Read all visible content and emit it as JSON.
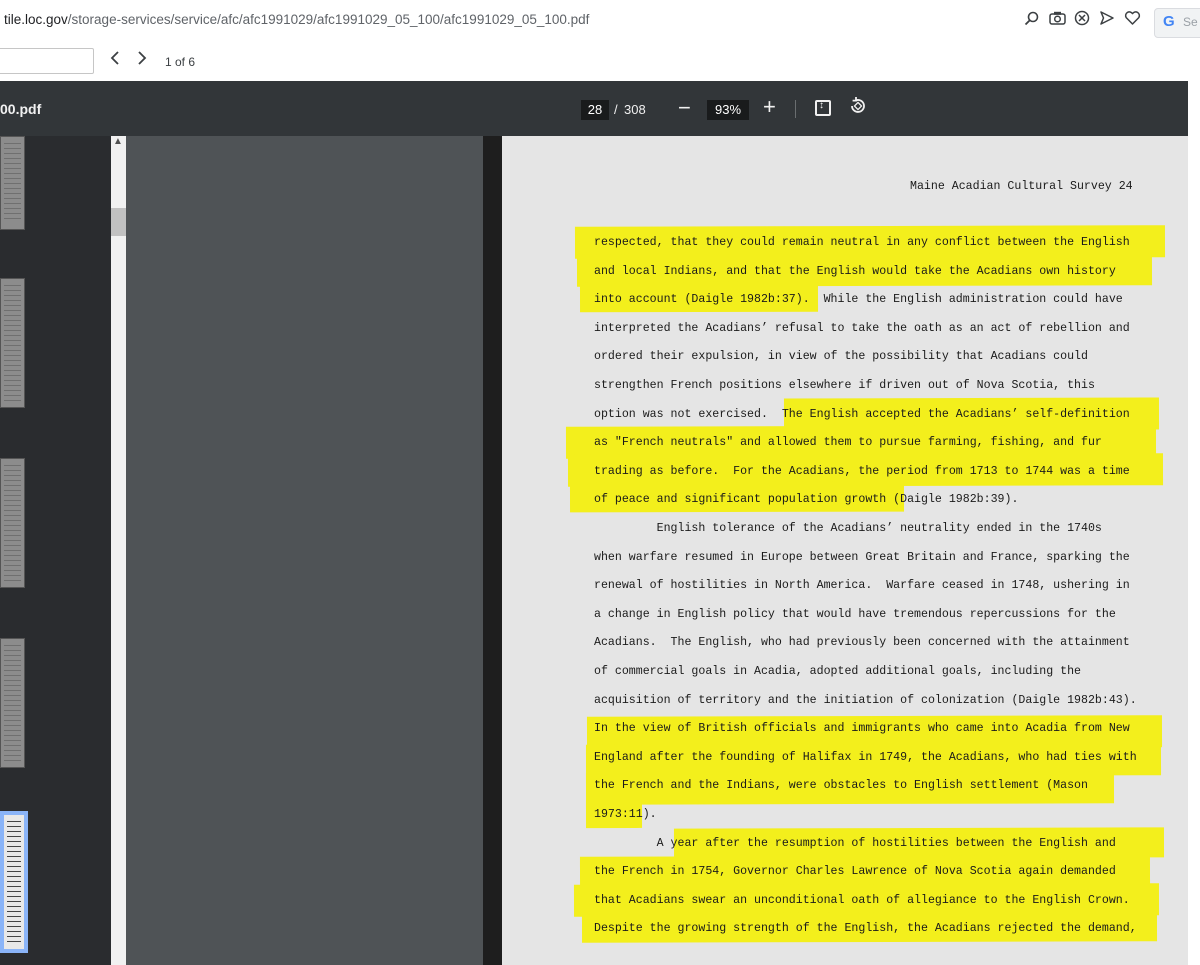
{
  "browser": {
    "url_host": "tile.loc.gov",
    "url_path": "/storage-services/service/afc/afc1991029/afc1991029_05_100/afc1991029_05_100.pdf",
    "icons": [
      "zoom-icon",
      "camera-icon",
      "close-circle-icon",
      "send-icon",
      "heart-icon"
    ],
    "search_badge": "G",
    "search_hint": "Se"
  },
  "find_bar": {
    "query": "",
    "count": "1 of 6"
  },
  "pdf_toolbar": {
    "filename": "00.pdf",
    "current_page": "28",
    "separator": "/",
    "total_pages": "308",
    "zoom_out": "−",
    "zoom": "93%",
    "zoom_in": "+"
  },
  "document": {
    "header": "Maine Acadian Cultural Survey   24",
    "lines": [
      "respected, that they could remain neutral in any conflict between the English",
      "and local Indians, and that the English would take the Acadians own history",
      "into account (Daigle 1982b:37).  While the English administration could have",
      "interpreted the Acadians’ refusal to take the oath as an act of rebellion and",
      "ordered their expulsion, in view of the possibility that Acadians could",
      "strengthen French positions elsewhere if driven out of Nova Scotia, this",
      "option was not exercised.  The English accepted the Acadians’ self-definition",
      "as \"French neutrals\" and allowed them to pursue farming, fishing, and fur",
      "trading as before.  For the Acadians, the period from 1713 to 1744 was a time",
      "of peace and significant population growth (Daigle 1982b:39).",
      "         English tolerance of the Acadians’ neutrality ended in the 1740s",
      "when warfare resumed in Europe between Great Britain and France, sparking the",
      "renewal of hostilities in North America.  Warfare ceased in 1748, ushering in",
      "a change in English policy that would have tremendous repercussions for the",
      "Acadians.  The English, who had previously been concerned with the attainment",
      "of commercial goals in Acadia, adopted additional goals, including the",
      "acquisition of territory and the initiation of colonization (Daigle 1982b:43).",
      "In the view of British officials and immigrants who came into Acadia from New",
      "England after the founding of Halifax in 1749, the Acadians, who had ties with",
      "the French and the Indians, were obstacles to English settlement (Mason",
      "1973:11).",
      "         A year after the resumption of hostilities between the English and",
      "the French in 1754, Governor Charles Lawrence of Nova Scotia again demanded",
      "that Acadians swear an unconditional oath of allegiance to the English Crown.",
      "Despite the growing strength of the English, the Acadians rejected the demand,"
    ],
    "highlight_color": "#f3ef1c"
  }
}
